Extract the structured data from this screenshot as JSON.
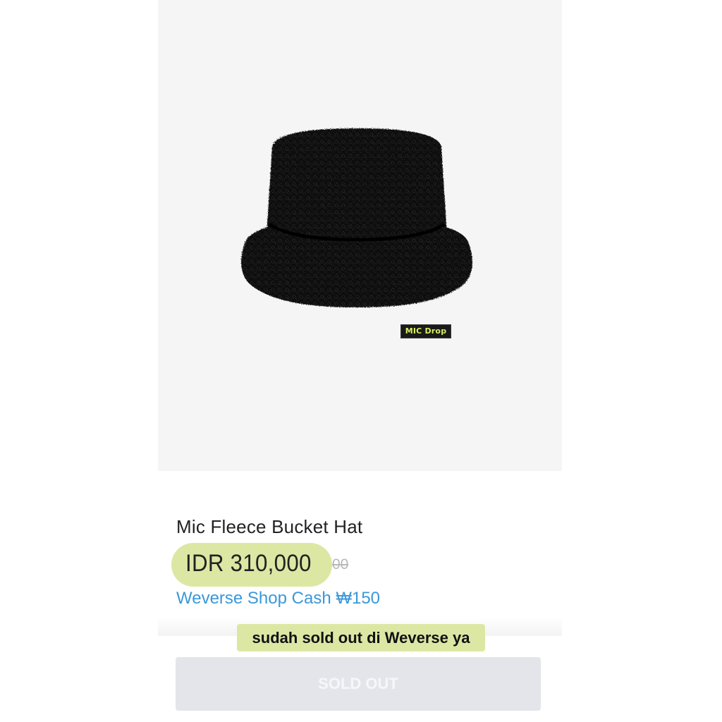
{
  "product": {
    "image_alt": "black fleece bucket hat",
    "hat_label": "MIC Drop",
    "title": "Mic Fleece Bucket Hat",
    "price": "IDR 310,000",
    "original_price_fragment": "00",
    "cash_reward": "Weverse Shop Cash ₩150"
  },
  "annotation": {
    "note": "sudah sold out di Weverse ya",
    "highlight_color": "#dde7a4"
  },
  "actions": {
    "sold_out_label": "SOLD OUT"
  },
  "colors": {
    "cash_text": "#3a98d9",
    "button_bg": "#e4e5ea",
    "label_text": "#d9f060"
  }
}
